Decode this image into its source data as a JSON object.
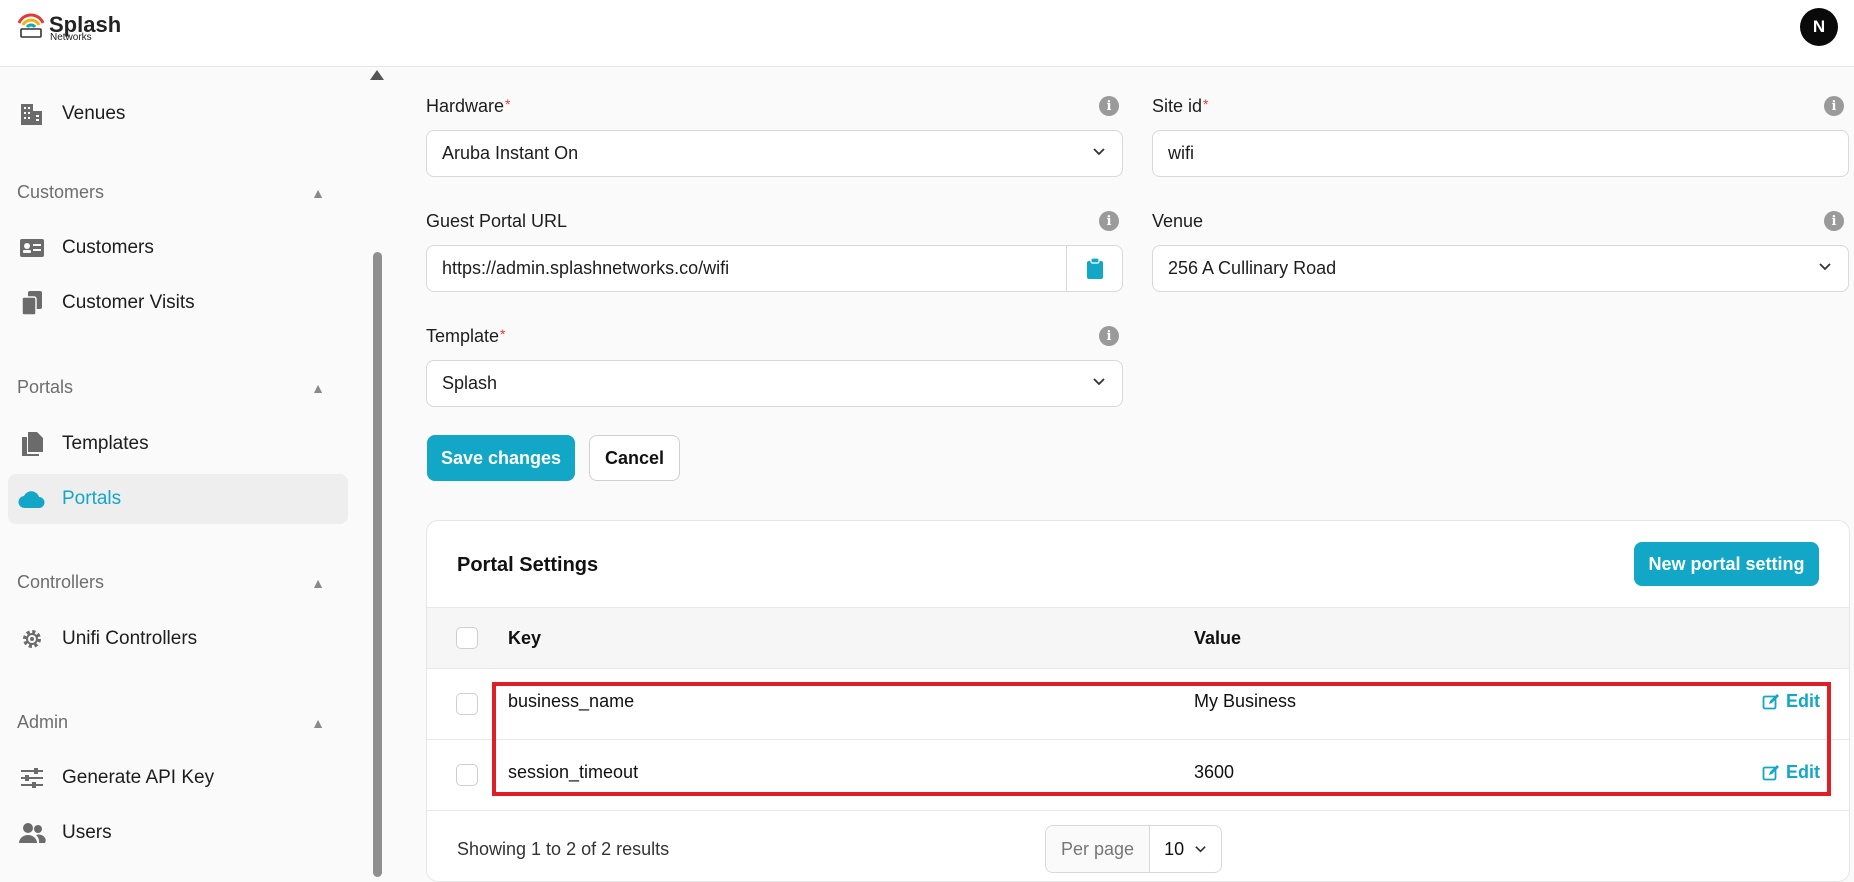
{
  "app": {
    "logo_text": "Splash",
    "logo_subtext": "Networks",
    "user_initial": "N"
  },
  "sidebar": {
    "top_item": {
      "label": "Venues",
      "icon": "building-icon"
    },
    "sections": [
      {
        "title": "Customers",
        "items": [
          {
            "label": "Customers",
            "icon": "id-card-icon"
          },
          {
            "label": "Customer Visits",
            "icon": "copy-icon"
          }
        ]
      },
      {
        "title": "Portals",
        "items": [
          {
            "label": "Templates",
            "icon": "files-icon"
          },
          {
            "label": "Portals",
            "icon": "cloud-icon",
            "active": true
          }
        ]
      },
      {
        "title": "Controllers",
        "items": [
          {
            "label": "Unifi Controllers",
            "icon": "gear-icon"
          }
        ]
      },
      {
        "title": "Admin",
        "items": [
          {
            "label": "Generate API Key",
            "icon": "sliders-icon"
          },
          {
            "label": "Users",
            "icon": "users-icon"
          }
        ]
      }
    ]
  },
  "form": {
    "hardware": {
      "label": "Hardware",
      "value": "Aruba Instant On"
    },
    "site_id": {
      "label": "Site id",
      "value": "wifi"
    },
    "guest_portal_url": {
      "label": "Guest Portal URL",
      "value": "https://admin.splashnetworks.co/wifi"
    },
    "venue": {
      "label": "Venue",
      "value": "256 A Cullinary Road"
    },
    "template": {
      "label": "Template",
      "value": "Splash"
    },
    "required_mark": "*",
    "save_label": "Save changes",
    "cancel_label": "Cancel"
  },
  "portal_settings": {
    "title": "Portal Settings",
    "new_button": "New portal setting",
    "columns": {
      "key": "Key",
      "value": "Value"
    },
    "rows": [
      {
        "key": "business_name",
        "value": "My Business",
        "action": "Edit"
      },
      {
        "key": "session_timeout",
        "value": "3600",
        "action": "Edit"
      }
    ],
    "summary": "Showing 1 to 2 of 2 results",
    "per_page_label": "Per page",
    "per_page_value": "10"
  },
  "colors": {
    "accent": "#13a7c7",
    "highlight": "#e01e26"
  }
}
